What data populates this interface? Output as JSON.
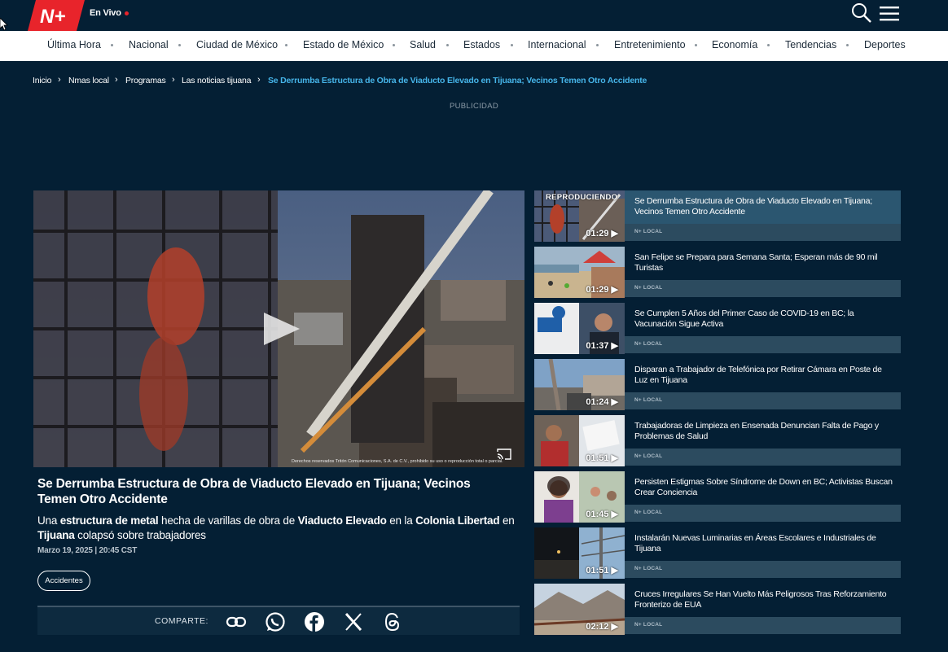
{
  "header": {
    "live_label": "En Vivo",
    "brand_color": "#e8242b"
  },
  "nav": {
    "items": [
      "Última Hora",
      "Nacional",
      "Ciudad de México",
      "Estado de México",
      "Salud",
      "Estados",
      "Internacional",
      "Entretenimiento",
      "Economía",
      "Tendencias",
      "Deportes"
    ]
  },
  "breadcrumb": [
    "Inicio",
    "Nmas local",
    "Programas",
    "Las noticias tijuana",
    "Se Derrumba Estructura de Obra de Viaducto Elevado en Tijuana; Vecinos Temen Otro Accidente"
  ],
  "publicity_label": "PUBLICIDAD",
  "video": {
    "copyright": "Derechos reservados Tritón Comunicaciones, S.A. de C.V., prohibido su uso o reproducción total o parcial."
  },
  "article": {
    "title": "Se Derrumba Estructura de Obra de Viaducto Elevado en Tijuana; Vecinos Temen Otro Accidente",
    "summary": {
      "s1": "Una ",
      "b1": "estructura de metal",
      "s2": " hecha de varillas de obra de ",
      "b2": "Viaducto Elevado",
      "s3": " en la ",
      "b3": "Colonia Libertad",
      "s4": " en ",
      "b4": "Tijuana",
      "s5": " colapsó sobre trabajadores"
    },
    "date": "Marzo 19, 2025 | 20:45 CST",
    "tag": "Accidentes"
  },
  "share": {
    "label": "COMPARTE:"
  },
  "playlist": {
    "playing_label": "REPRODUCIENDO",
    "items": [
      {
        "title": "Se Derrumba Estructura de Obra de Viaducto Elevado en Tijuana; Vecinos Temen Otro Accidente",
        "duration": "01:29",
        "source": "N+ LOCAL"
      },
      {
        "title": "San Felipe se Prepara para Semana Santa; Esperan más de 90 mil Turistas",
        "duration": "01:29",
        "source": "N+ LOCAL"
      },
      {
        "title": "Se Cumplen 5 Años del Primer Caso de COVID-19 en BC; la Vacunación Sigue Activa",
        "duration": "01:37",
        "source": "N+ LOCAL"
      },
      {
        "title": "Disparan a Trabajador de Telefónica por Retirar Cámara en Poste de Luz en Tijuana",
        "duration": "01:24",
        "source": "N+ LOCAL"
      },
      {
        "title": "Trabajadoras de Limpieza en Ensenada Denuncian Falta de Pago y Problemas de Salud",
        "duration": "01:51",
        "source": "N+ LOCAL"
      },
      {
        "title": "Persisten Estigmas Sobre Síndrome de Down en BC; Activistas Buscan Crear Conciencia",
        "duration": "01:45",
        "source": "N+ LOCAL"
      },
      {
        "title": "Instalarán Nuevas Luminarias en Áreas Escolares e Industriales de Tijuana",
        "duration": "01:51",
        "source": "N+ LOCAL"
      },
      {
        "title": "Cruces Irregulares Se Han Vuelto Más Peligrosos Tras Reforzamiento Fronterizo de EUA",
        "duration": "02:12",
        "source": "N+ LOCAL"
      }
    ]
  }
}
